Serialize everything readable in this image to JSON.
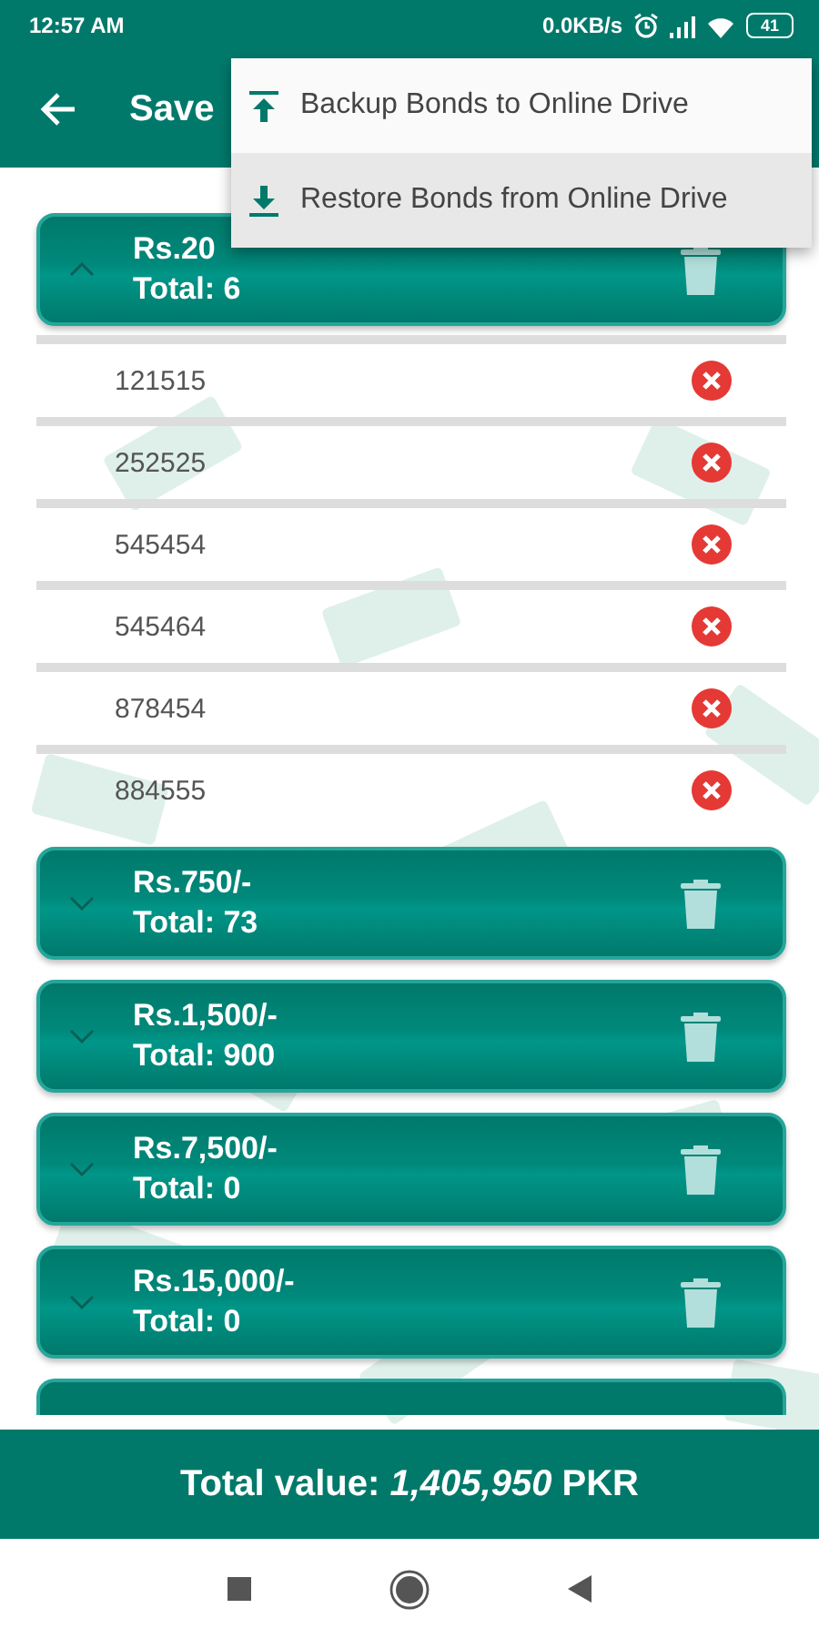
{
  "status_bar": {
    "time": "12:57 AM",
    "speed": "0.0KB/s",
    "battery": "41"
  },
  "app_bar": {
    "title": "Save"
  },
  "menu": [
    {
      "label": "Backup Bonds to Online Drive",
      "selected": false
    },
    {
      "label": "Restore Bonds from Online Drive",
      "selected": true
    }
  ],
  "groups": [
    {
      "amount": "Rs.20",
      "total": "Total: 6",
      "expanded": true,
      "bonds": [
        "121515",
        "252525",
        "545454",
        "545464",
        "878454",
        "884555"
      ]
    },
    {
      "amount": "Rs.750/-",
      "total": "Total: 73",
      "expanded": false
    },
    {
      "amount": "Rs.1,500/-",
      "total": "Total: 900",
      "expanded": false
    },
    {
      "amount": "Rs.7,500/-",
      "total": "Total: 0",
      "expanded": false
    },
    {
      "amount": "Rs.15,000/-",
      "total": "Total: 0",
      "expanded": false
    }
  ],
  "more_groups_below": true,
  "footer": {
    "label": "Total value:",
    "value": "1,405,950",
    "currency": "PKR"
  }
}
